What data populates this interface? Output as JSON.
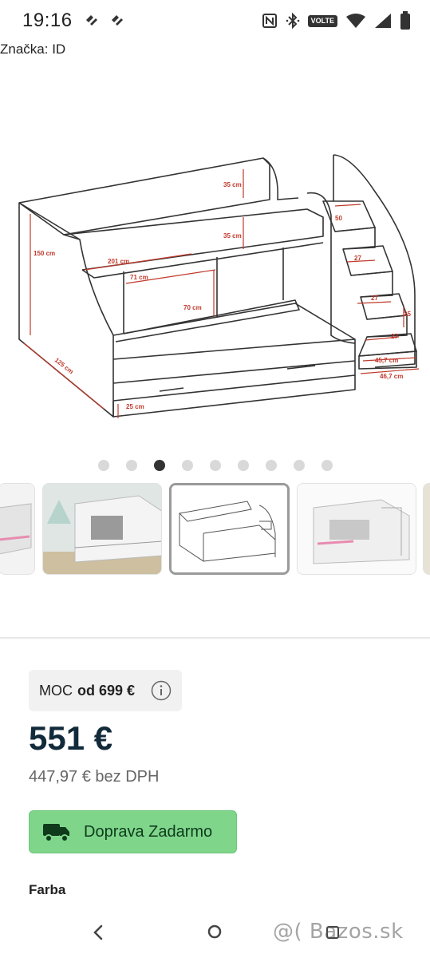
{
  "status_bar": {
    "time": "19:16",
    "volte": "VOLTE",
    "icons": [
      "notification-icon",
      "notification-icon",
      "nfc-icon",
      "bluetooth-icon",
      "volte-icon",
      "wifi-icon",
      "signal-icon",
      "battery-icon"
    ]
  },
  "brand": "Značka: ID",
  "product_image": {
    "dimensions": {
      "d35a": "35 cm",
      "d35b": "35 cm",
      "d150": "150 cm",
      "d201": "201 cm",
      "d71": "71 cm",
      "d70": "70 cm",
      "d125": "125 cm",
      "d25a": "25 cm",
      "d50": "50",
      "d27a": "27",
      "d27b": "27",
      "d27c": "27",
      "d25b": "25",
      "d457": "45,7 cm",
      "d467": "46,7 cm"
    }
  },
  "carousel": {
    "count": 9,
    "active_index": 2
  },
  "thumbnails": {
    "count": 5,
    "active_index": 2
  },
  "price_box": {
    "moc_label": "MOC",
    "moc_value": "od 699 €",
    "price": "551 €",
    "price_net": "447,97 € bez DPH"
  },
  "shipping": {
    "label": "Doprava Zadarmo"
  },
  "color_section": {
    "label": "Farba"
  },
  "watermark": "@( Bazos.sk",
  "colors": {
    "accent_green": "#7fd68b",
    "price_color": "#122b3a",
    "dimension_red": "#c0392b"
  }
}
